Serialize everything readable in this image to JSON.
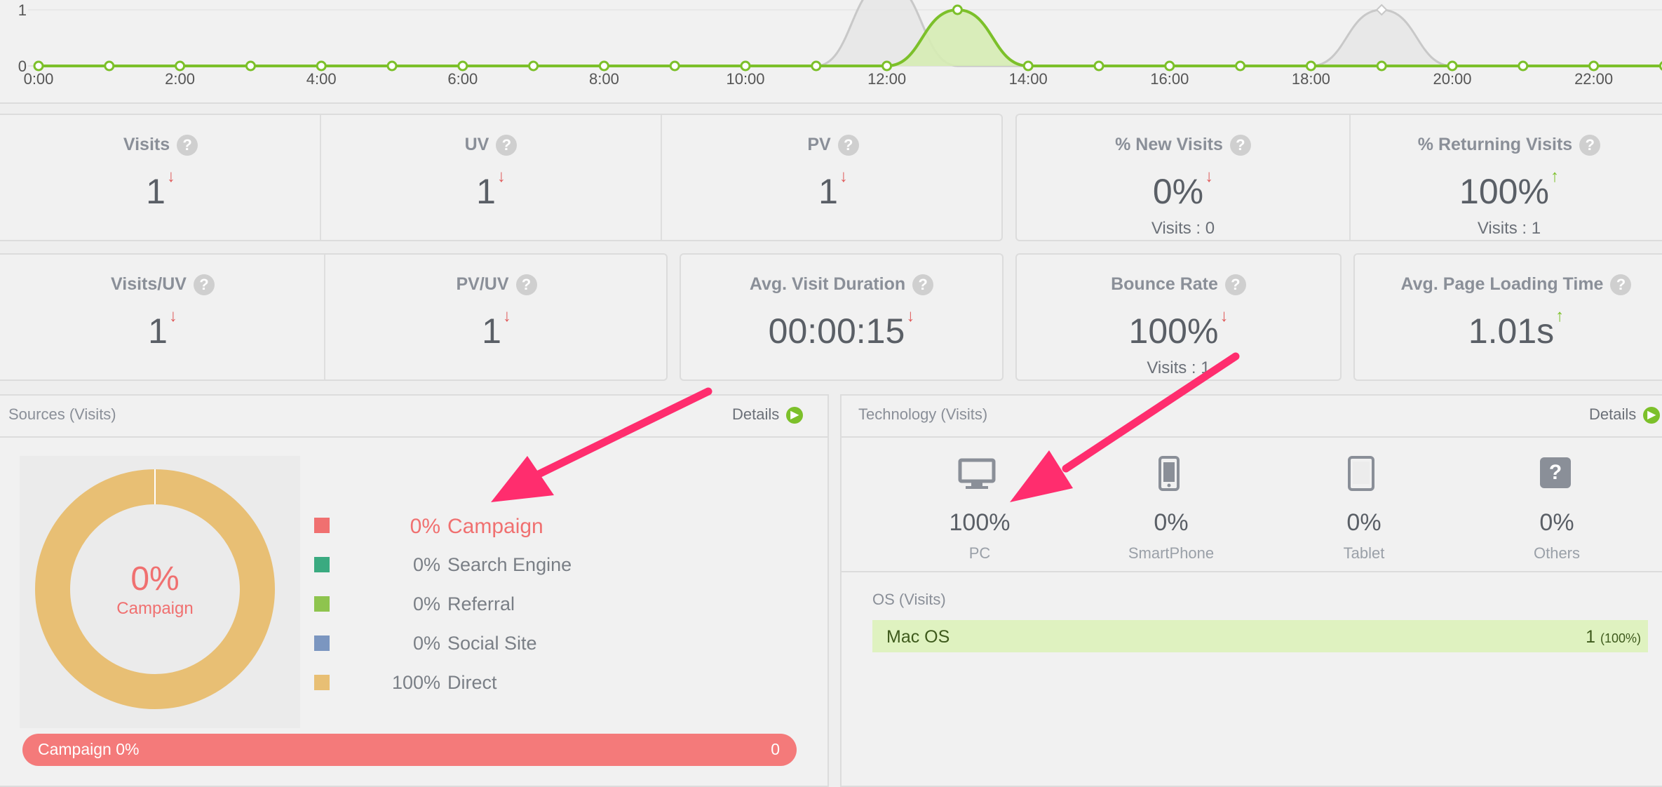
{
  "chart": {
    "y_ticks": [
      "1",
      "0"
    ],
    "x_labels": [
      "0:00",
      "2:00",
      "4:00",
      "6:00",
      "8:00",
      "10:00",
      "12:00",
      "14:00",
      "16:00",
      "18:00",
      "20:00",
      "22:00"
    ],
    "colors": {
      "current": "#7cc02a",
      "current_fill": "#d6ecb4",
      "previous": "#c8c8c8"
    }
  },
  "chart_data": {
    "type": "area",
    "x": [
      "0:00",
      "1:00",
      "2:00",
      "3:00",
      "4:00",
      "5:00",
      "6:00",
      "7:00",
      "8:00",
      "9:00",
      "10:00",
      "11:00",
      "12:00",
      "13:00",
      "14:00",
      "15:00",
      "16:00",
      "17:00",
      "18:00",
      "19:00",
      "20:00",
      "21:00",
      "22:00",
      "23:00"
    ],
    "series": [
      {
        "values": [
          0,
          0,
          0,
          0,
          0,
          0,
          0,
          0,
          0,
          0,
          0,
          0,
          0,
          1,
          0,
          0,
          0,
          0,
          0,
          0,
          0,
          0,
          0,
          0
        ]
      },
      {
        "values": [
          0,
          0,
          0,
          0,
          0,
          0,
          0,
          0,
          0,
          0,
          0,
          0,
          1.5,
          0,
          0,
          0,
          0,
          0,
          0,
          1,
          0,
          0,
          0,
          0
        ]
      }
    ],
    "ylim": [
      0,
      1
    ],
    "grid": true
  },
  "stats_row1": [
    {
      "title": "Visits",
      "value": "1",
      "trend": "down",
      "sub": ""
    },
    {
      "title": "UV",
      "value": "1",
      "trend": "down",
      "sub": ""
    },
    {
      "title": "PV",
      "value": "1",
      "trend": "down",
      "sub": ""
    },
    {
      "title": "% New Visits",
      "value": "0%",
      "trend": "down",
      "sub": "Visits : 0"
    },
    {
      "title": "% Returning Visits",
      "value": "100%",
      "trend": "up",
      "sub": "Visits : 1"
    }
  ],
  "stats_row2": [
    {
      "title": "Visits/UV",
      "value": "1",
      "trend": "down",
      "sub": ""
    },
    {
      "title": "PV/UV",
      "value": "1",
      "trend": "down",
      "sub": ""
    },
    {
      "title": "Avg. Visit Duration",
      "value": "00:00:15",
      "trend": "down",
      "sub": ""
    },
    {
      "title": "Bounce Rate",
      "value": "100%",
      "trend": "down",
      "sub": "Visits : 1"
    },
    {
      "title": "Avg. Page Loading Time",
      "value": "1.01s",
      "trend": "up",
      "sub": ""
    }
  ],
  "help_glyph": "?",
  "arrow_down_glyph": "↓",
  "arrow_up_glyph": "↑",
  "sources": {
    "title": "Sources (Visits)",
    "details": "Details",
    "donut_pct": "0%",
    "donut_label": "Campaign",
    "donut_color": "#e8bf74",
    "legend": [
      {
        "pct": "0%",
        "name": "Campaign",
        "color": "#f07070",
        "highlight": true
      },
      {
        "pct": "0%",
        "name": "Search Engine",
        "color": "#3aaa80",
        "highlight": false
      },
      {
        "pct": "0%",
        "name": "Referral",
        "color": "#8ec44e",
        "highlight": false
      },
      {
        "pct": "0%",
        "name": "Social Site",
        "color": "#7b96c0",
        "highlight": false
      },
      {
        "pct": "100%",
        "name": "Direct",
        "color": "#e8bf74",
        "highlight": false
      }
    ],
    "bar_label": "Campaign 0%",
    "bar_value": "0"
  },
  "technology": {
    "title": "Technology (Visits)",
    "details": "Details",
    "devices": [
      {
        "icon": "monitor-icon",
        "value": "100%",
        "label": "PC"
      },
      {
        "icon": "smartphone-icon",
        "value": "0%",
        "label": "SmartPhone"
      },
      {
        "icon": "tablet-icon",
        "value": "0%",
        "label": "Tablet"
      },
      {
        "icon": "question-icon",
        "value": "0%",
        "label": "Others"
      }
    ],
    "os_title": "OS (Visits)",
    "os_rows": [
      {
        "name": "Mac OS",
        "value": "1",
        "pct": "(100%)",
        "share": 1.0
      }
    ]
  },
  "annotation_color": "#ff2d6e"
}
